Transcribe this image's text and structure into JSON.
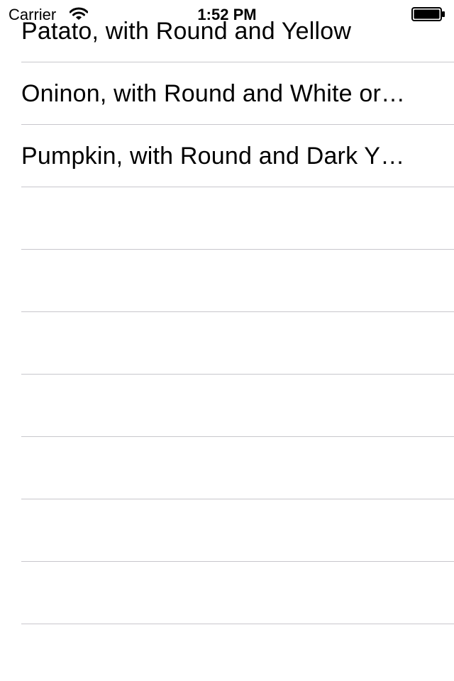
{
  "status_bar": {
    "carrier": "Carrier",
    "time": "1:52 PM",
    "wifi_icon": "wifi-icon",
    "battery_icon": "battery-full-icon",
    "battery_level": 1.0
  },
  "list": {
    "items": [
      {
        "label": "Patato, with Round and Yellow"
      },
      {
        "label": "Oninon, with Round and White or…"
      },
      {
        "label": "Pumpkin, with Round and Dark Y…"
      },
      {
        "label": ""
      },
      {
        "label": ""
      },
      {
        "label": ""
      },
      {
        "label": ""
      },
      {
        "label": ""
      },
      {
        "label": ""
      },
      {
        "label": ""
      }
    ]
  },
  "colors": {
    "background": "#ffffff",
    "separator": "#c8c7cc",
    "text": "#000000"
  }
}
